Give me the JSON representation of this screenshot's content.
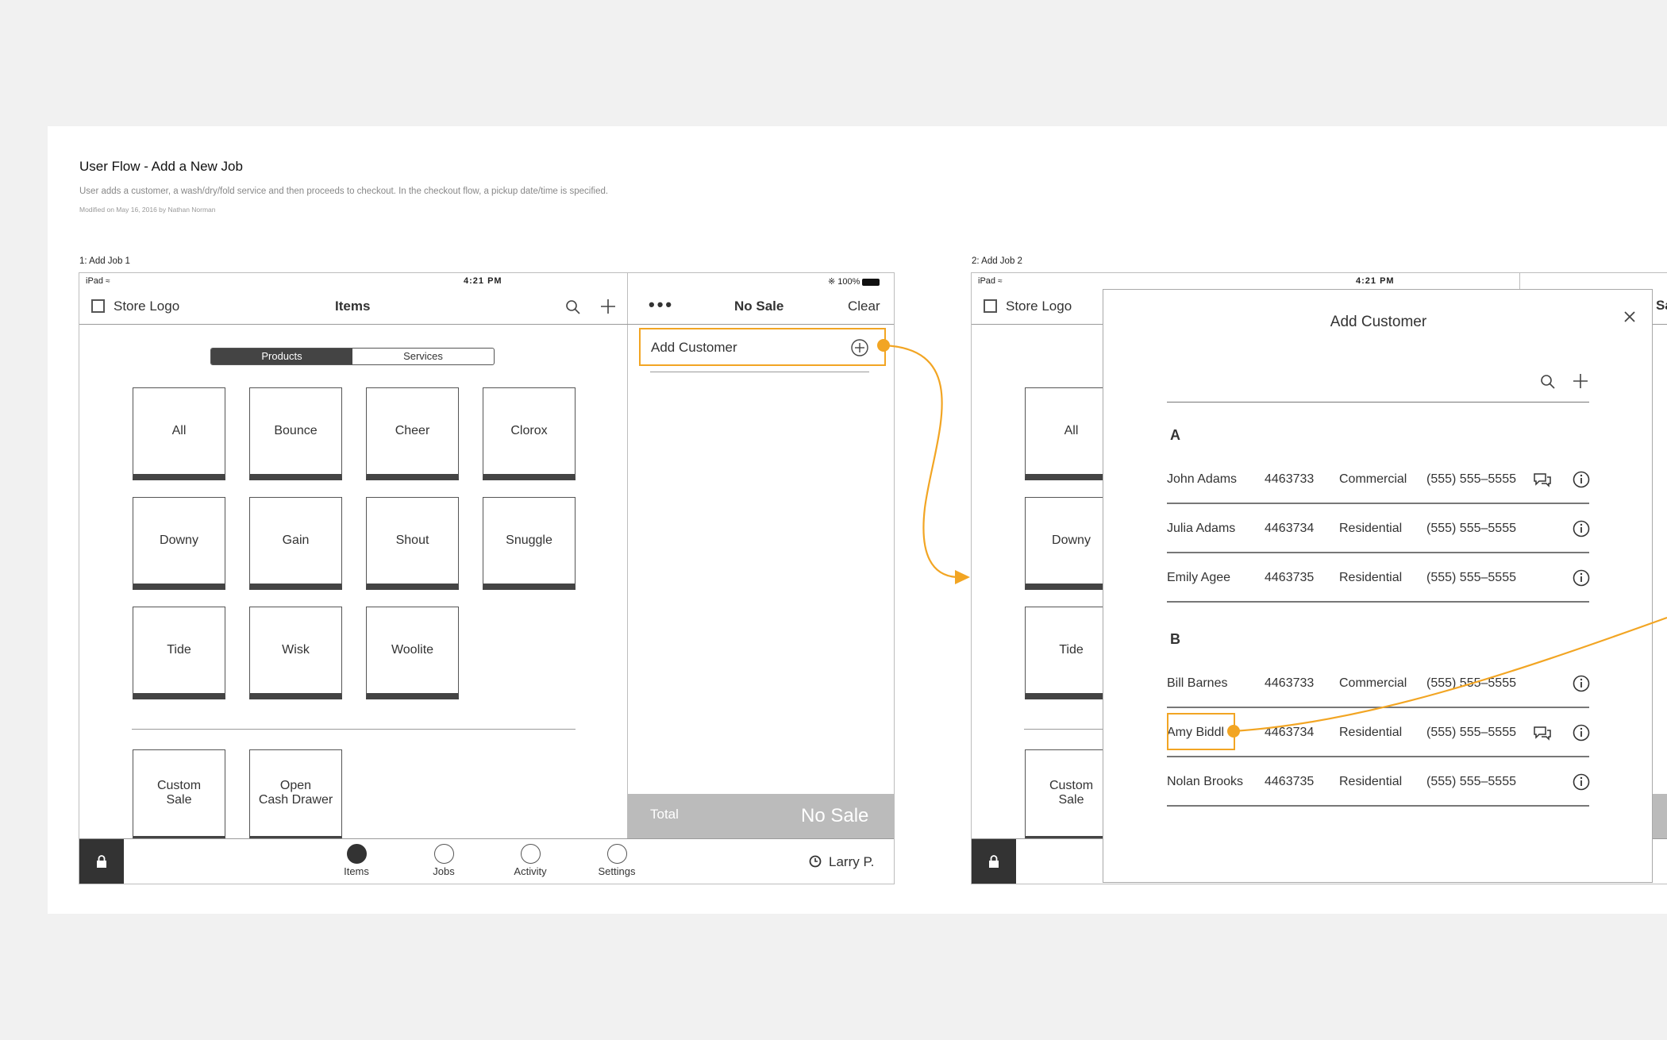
{
  "title": "User Flow - Add a New Job",
  "description": "User adds a customer, a wash/dry/fold service and then proceeds to checkout. In the checkout flow, a pickup date/time is specified.",
  "modified": "Modified on May 16, 2016 by Nathan Norman",
  "frame1": {
    "label": "1: Add Job 1",
    "status": {
      "device": "iPad",
      "time": "4:21 PM",
      "battery": "100%"
    },
    "store_logo": "Store Logo",
    "items_title": "Items",
    "segments": [
      "Products",
      "Services"
    ],
    "tiles": [
      "All",
      "Bounce",
      "Cheer",
      "Clorox",
      "Downy",
      "Gain",
      "Shout",
      "Snuggle",
      "Tide",
      "Wisk",
      "Woolite"
    ],
    "custom_tiles": [
      "Custom\nSale",
      "Open\nCash Drawer"
    ],
    "cart": {
      "title": "No Sale",
      "clear": "Clear",
      "add_customer": "Add Customer",
      "total_label": "Total",
      "total_value": "No Sale"
    },
    "tabs": [
      "Items",
      "Jobs",
      "Activity",
      "Settings"
    ],
    "user": "Larry P."
  },
  "frame2": {
    "label": "2: Add Job 2",
    "status": {
      "device": "iPad",
      "time": "4:21 PM"
    },
    "store_logo": "Store Logo",
    "cart_title_partial": "Sal",
    "bg_tiles": [
      "All",
      "Downy",
      "Tide",
      "Custom\nSale"
    ],
    "modal": {
      "title": "Add Customer",
      "sections": [
        {
          "letter": "A",
          "rows": [
            {
              "name": "John Adams",
              "id": "4463733",
              "type": "Commercial",
              "phone": "(555) 555–5555",
              "chat": true
            },
            {
              "name": "Julia Adams",
              "id": "4463734",
              "type": "Residential",
              "phone": "(555) 555–5555",
              "chat": false
            },
            {
              "name": "Emily Agee",
              "id": "4463735",
              "type": "Residential",
              "phone": "(555) 555–5555",
              "chat": false
            }
          ]
        },
        {
          "letter": "B",
          "rows": [
            {
              "name": "Bill Barnes",
              "id": "4463733",
              "type": "Commercial",
              "phone": "(555) 555–5555",
              "chat": false
            },
            {
              "name": "Amy Biddl",
              "id": "4463734",
              "type": "Residential",
              "phone": "(555) 555–5555",
              "chat": true
            },
            {
              "name": "Nolan Brooks",
              "id": "4463735",
              "type": "Residential",
              "phone": "(555) 555–5555",
              "chat": false
            }
          ]
        }
      ]
    }
  },
  "colors": {
    "accent": "#f2a523",
    "dark": "#444444",
    "total_bg": "#bbbbbb"
  }
}
